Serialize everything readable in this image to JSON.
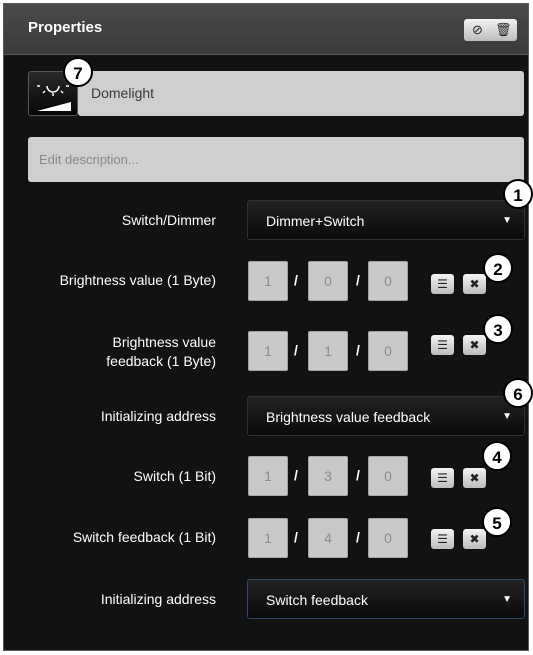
{
  "panel": {
    "title": "Properties",
    "header_icons": [
      "check-circle-icon",
      "trash-icon"
    ]
  },
  "device": {
    "name": "Domelight",
    "icon": "dimmer-light-icon",
    "description_placeholder": "Edit description..."
  },
  "rows": {
    "switch_dimmer": {
      "label": "Switch/Dimmer",
      "value": "Dimmer+Switch"
    },
    "brightness_value": {
      "label": "Brightness value (1 Byte)",
      "address": [
        "1",
        "0",
        "0"
      ]
    },
    "brightness_feedback": {
      "label_line1": "Brightness value",
      "label_line2": "feedback (1 Byte)",
      "address": [
        "1",
        "1",
        "0"
      ]
    },
    "init_address_1": {
      "label": "Initializing address",
      "value": "Brightness value feedback"
    },
    "switch": {
      "label": "Switch (1 Bit)",
      "address": [
        "1",
        "3",
        "0"
      ]
    },
    "switch_feedback": {
      "label": "Switch feedback (1 Bit)",
      "address": [
        "1",
        "4",
        "0"
      ]
    },
    "init_address_2": {
      "label": "Initializing address",
      "value": "Switch feedback"
    }
  },
  "separator": "/",
  "callouts": [
    "1",
    "2",
    "3",
    "4",
    "5",
    "6",
    "7"
  ]
}
